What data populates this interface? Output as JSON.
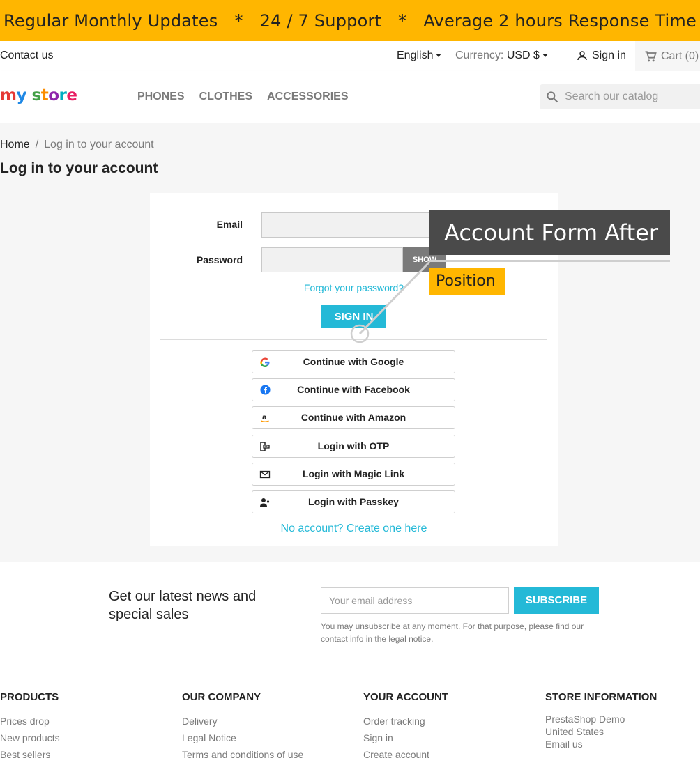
{
  "promo": {
    "item1": "Regular Monthly Updates",
    "sep": "*",
    "item2": "24 / 7 Support",
    "item3": "Average 2 hours Response Time"
  },
  "topbar": {
    "contact": "Contact us",
    "language": "English",
    "currency_label": "Currency:",
    "currency_value": "USD $",
    "signin": "Sign in",
    "cart": "Cart (0)"
  },
  "header": {
    "logo": [
      "m",
      "y",
      " ",
      "s",
      "t",
      "o",
      "r",
      "e"
    ],
    "nav": [
      "PHONES",
      "CLOTHES",
      "ACCESSORIES"
    ],
    "search_placeholder": "Search our catalog"
  },
  "breadcrumb": {
    "home": "Home",
    "sep": "/",
    "current": "Log in to your account"
  },
  "page_title": "Log in to your account",
  "login_form": {
    "email_label": "Email",
    "password_label": "Password",
    "show_label": "SHOW",
    "forgot": "Forgot your password?",
    "signin_button": "SIGN IN",
    "social": [
      {
        "label": "Continue with Google",
        "icon": "google-icon"
      },
      {
        "label": "Continue with Facebook",
        "icon": "facebook-icon"
      },
      {
        "label": "Continue with Amazon",
        "icon": "amazon-icon"
      },
      {
        "label": "Login with OTP",
        "icon": "otp-icon"
      },
      {
        "label": "Login with Magic Link",
        "icon": "envelope-icon"
      },
      {
        "label": "Login with Passkey",
        "icon": "passkey-icon"
      }
    ],
    "no_account": "No account? Create one here"
  },
  "annotation": {
    "title": "Account Form After",
    "subtitle": "Position"
  },
  "newsletter": {
    "title": "Get our latest news and special sales",
    "placeholder": "Your email address",
    "button": "SUBSCRIBE",
    "note": "You may unsubscribe at any moment. For that purpose, please find our contact info in the legal notice."
  },
  "footer": {
    "products": {
      "title": "PRODUCTS",
      "links": [
        "Prices drop",
        "New products",
        "Best sellers"
      ]
    },
    "company": {
      "title": "OUR COMPANY",
      "links": [
        "Delivery",
        "Legal Notice",
        "Terms and conditions of use"
      ]
    },
    "account": {
      "title": "YOUR ACCOUNT",
      "links": [
        "Order tracking",
        "Sign in",
        "Create account"
      ]
    },
    "store": {
      "title": "STORE INFORMATION",
      "lines": [
        "PrestaShop Demo",
        "United States",
        "Email us"
      ]
    }
  },
  "colors": {
    "accent": "#24b9d7",
    "promo": "#ffb600",
    "tag_dark": "#4a4a4a"
  }
}
